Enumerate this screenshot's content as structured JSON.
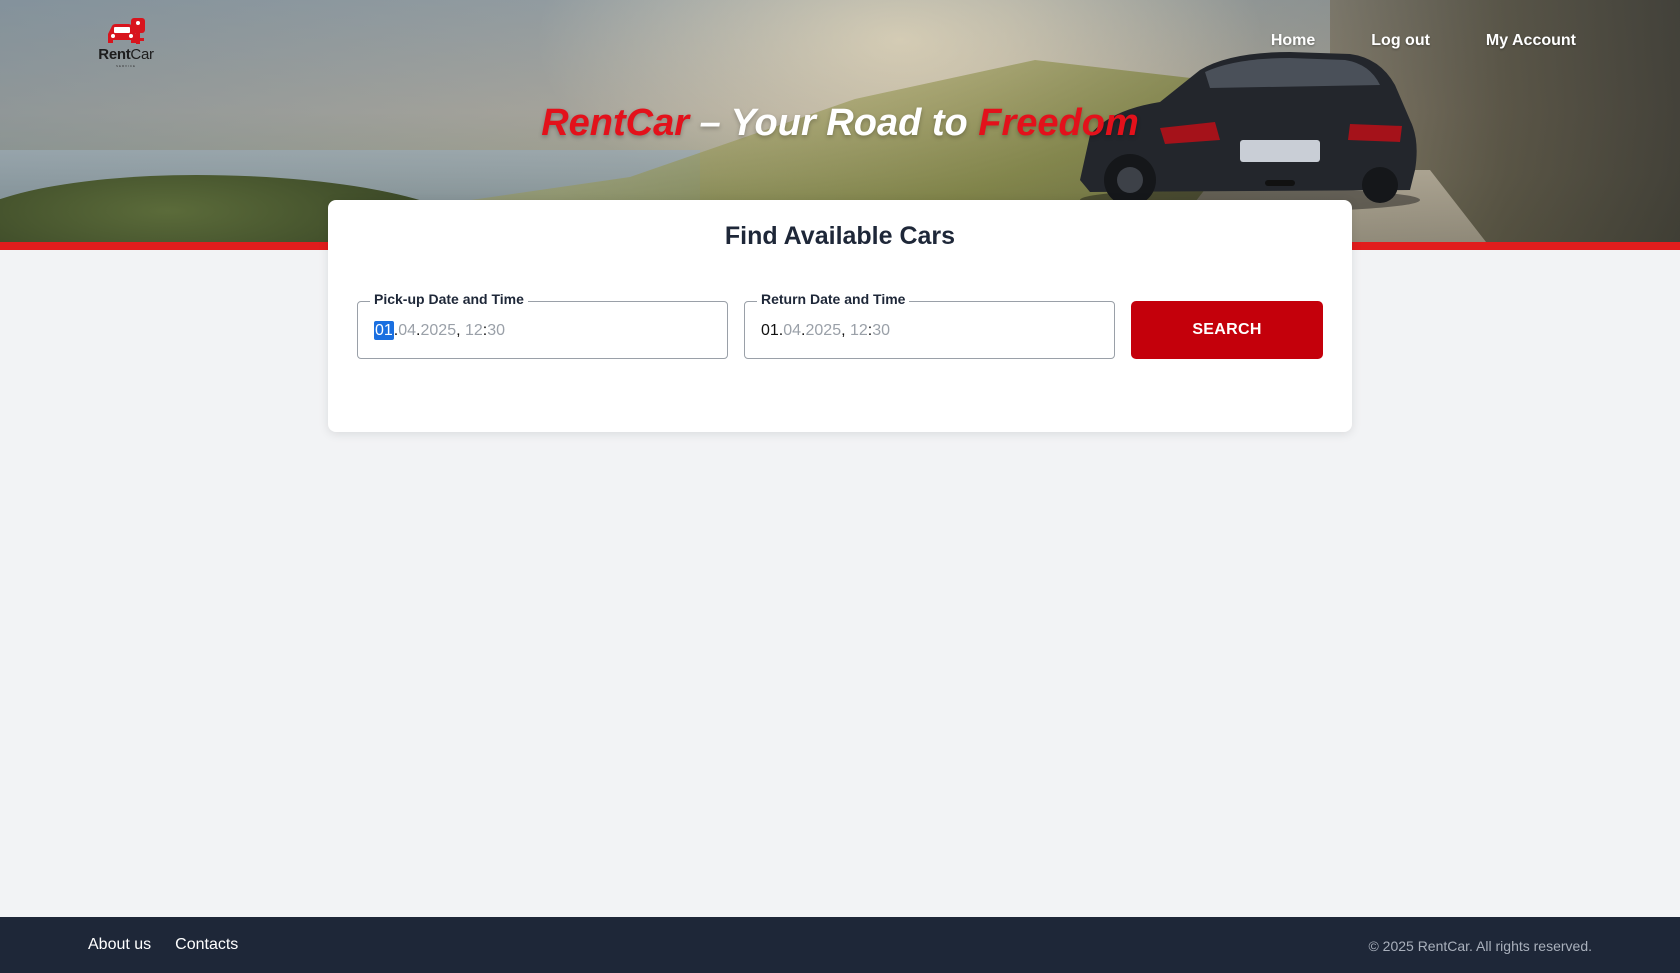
{
  "brand": {
    "logo_word_bold": "Rent",
    "logo_word_light": "Car",
    "logo_subtitle": "SERVICE",
    "accent_color": "#e3111b",
    "button_color": "#c4000b"
  },
  "nav": {
    "items": [
      {
        "label": "Home"
      },
      {
        "label": "Log out"
      },
      {
        "label": "My Account"
      }
    ]
  },
  "hero": {
    "title_part1": "RentCar",
    "title_part2": " – Your Road to ",
    "title_part3": "Freedom"
  },
  "search": {
    "title": "Find Available Cars",
    "pickup": {
      "label": "Pick-up Date and Time",
      "day": "01",
      "sep1": ".",
      "month": "04",
      "sep2": ".",
      "year": "2025",
      "sep3": ", ",
      "hour": "12",
      "sep4": ":",
      "minute": "30"
    },
    "return": {
      "label": "Return Date and Time",
      "day": "01",
      "sep1": ".",
      "month": "04",
      "sep2": ".",
      "year": "2025",
      "sep3": ", ",
      "hour": "12",
      "sep4": ":",
      "minute": "30"
    },
    "button_label": "SEARCH"
  },
  "footer": {
    "links": [
      {
        "label": "About us"
      },
      {
        "label": "Contacts"
      }
    ],
    "copyright": "© 2025 RentCar. All rights reserved."
  }
}
